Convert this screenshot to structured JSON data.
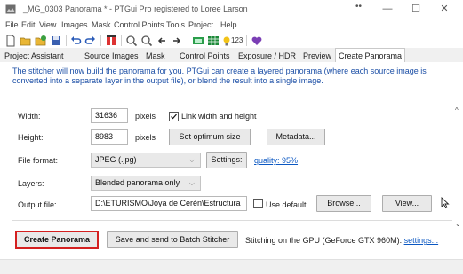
{
  "window": {
    "title": "_MG_0303 Panorama * - PTGui Pro registered to Loree Larson",
    "dots": "••"
  },
  "menu": [
    "File",
    "Edit",
    "View",
    "Images",
    "Mask",
    "Control Points",
    "Tools",
    "Project",
    "Help"
  ],
  "toolbar": {
    "counter_label": "123"
  },
  "tabs": [
    {
      "label": "Project Assistant"
    },
    {
      "label": "Source Images"
    },
    {
      "label": "Mask"
    },
    {
      "label": "Control Points"
    },
    {
      "label": "Exposure / HDR"
    },
    {
      "label": "Preview"
    },
    {
      "label": "Create Panorama",
      "active": true
    }
  ],
  "instructions": "The stitcher will now build the panorama for you. PTGui can create a layered panorama (where each source image is converted into a separate layer in the output file), or blend the result into a single image.",
  "form": {
    "width_label": "Width:",
    "width_value": "31636",
    "height_label": "Height:",
    "height_value": "8983",
    "pixels_unit": "pixels",
    "link_label": "Link width and height",
    "link_checked": true,
    "optimum_label": "Set optimum size",
    "metadata_label": "Metadata...",
    "format_label": "File format:",
    "format_value": "JPEG (.jpg)",
    "settings_label": "Settings:",
    "quality_link": "quality: 95%",
    "layers_label": "Layers:",
    "layers_value": "Blended panorama only",
    "output_label": "Output file:",
    "output_value": "D:\\ETURISMO\\Joya de Cerén\\Estructura",
    "use_default_label": "Use default",
    "use_default_checked": false,
    "browse_label": "Browse...",
    "view_label": "View..."
  },
  "bottom": {
    "create_label": "Create Panorama",
    "batch_label": "Save and send to Batch Stitcher",
    "gpu_text": "Stitching on the GPU (GeForce GTX 960M).",
    "gpu_settings_link": "settings..."
  },
  "colors": {
    "instruction_text": "#1c4fa6",
    "link": "#0a57c2",
    "highlight_border": "#d42020"
  }
}
